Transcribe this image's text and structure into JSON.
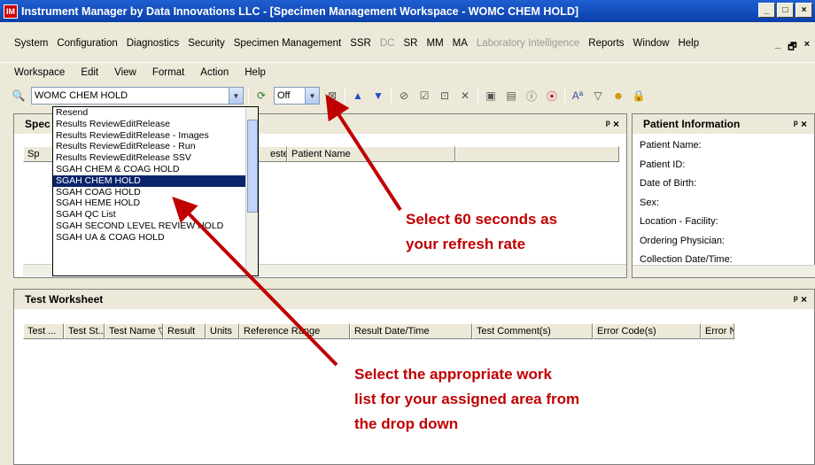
{
  "window": {
    "app_icon": "IM",
    "title": "Instrument Manager by Data Innovations LLC - [Specimen Management Workspace - WOMC CHEM HOLD]",
    "controls": [
      "_",
      "□",
      "×"
    ]
  },
  "main_menu": [
    {
      "label": "System",
      "enabled": true
    },
    {
      "label": "Configuration",
      "enabled": true
    },
    {
      "label": "Diagnostics",
      "enabled": true
    },
    {
      "label": "Security",
      "enabled": true
    },
    {
      "label": "Specimen Management",
      "enabled": true
    },
    {
      "label": "SSR",
      "enabled": true
    },
    {
      "label": "DC",
      "enabled": false
    },
    {
      "label": "SR",
      "enabled": true
    },
    {
      "label": "MM",
      "enabled": true
    },
    {
      "label": "MA",
      "enabled": true
    },
    {
      "label": "Laboratory Intelligence",
      "enabled": false
    },
    {
      "label": "Reports",
      "enabled": true
    },
    {
      "label": "Window",
      "enabled": true
    },
    {
      "label": "Help",
      "enabled": true
    }
  ],
  "mdi_controls": [
    "_",
    "🗗",
    "×"
  ],
  "workspace_menu": [
    "Workspace",
    "Edit",
    "View",
    "Format",
    "Action",
    "Help"
  ],
  "toolbar": {
    "worklist_value": "WOMC CHEM HOLD",
    "refresh_value": "Off"
  },
  "worklist_dropdown": {
    "items": [
      "Resend",
      "Results ReviewEditRelease",
      "Results ReviewEditRelease - Images",
      "Results ReviewEditRelease - Run",
      "Results ReviewEditRelease SSV",
      "SGAH CHEM & COAG HOLD",
      "SGAH CHEM HOLD",
      "SGAH COAG HOLD",
      "SGAH HEME HOLD",
      "SGAH QC List",
      "SGAH SECOND LEVEL REVIEW HOLD",
      "SGAH UA & COAG HOLD"
    ],
    "selected_index": 6
  },
  "specimen_panel": {
    "title": "Spec",
    "columns": [
      "Sp",
      "ested Date/Time ▽",
      "Patient Name"
    ],
    "pin": "ᵖ ×"
  },
  "patient_panel": {
    "title": "Patient Information",
    "pin": "ᵖ ×",
    "fields": [
      "Patient Name:",
      "Patient ID:",
      "Date of Birth:",
      "Sex:",
      "Location - Facility:",
      "Ordering Physician:",
      "Collection Date/Time:"
    ]
  },
  "test_panel": {
    "title": "Test Worksheet",
    "pin": "ᵖ ×",
    "columns": [
      "Test ...",
      "Test St...",
      "Test Name ▽",
      "Result",
      "Units",
      "Reference Range",
      "Result Date/Time",
      "Test Comment(s)",
      "Error Code(s)",
      "Error Nar"
    ]
  },
  "callouts": {
    "refresh_line1": "Select 60 seconds as",
    "refresh_line2": "your refresh rate",
    "worklist_line1": "Select the appropriate work",
    "worklist_line2": "list for your assigned area from",
    "worklist_line3": "the drop down"
  },
  "colors": {
    "title_bar": "#0a3fa8",
    "selection": "#0a246a",
    "callout": "#c00000",
    "chrome": "#ece9d8"
  }
}
